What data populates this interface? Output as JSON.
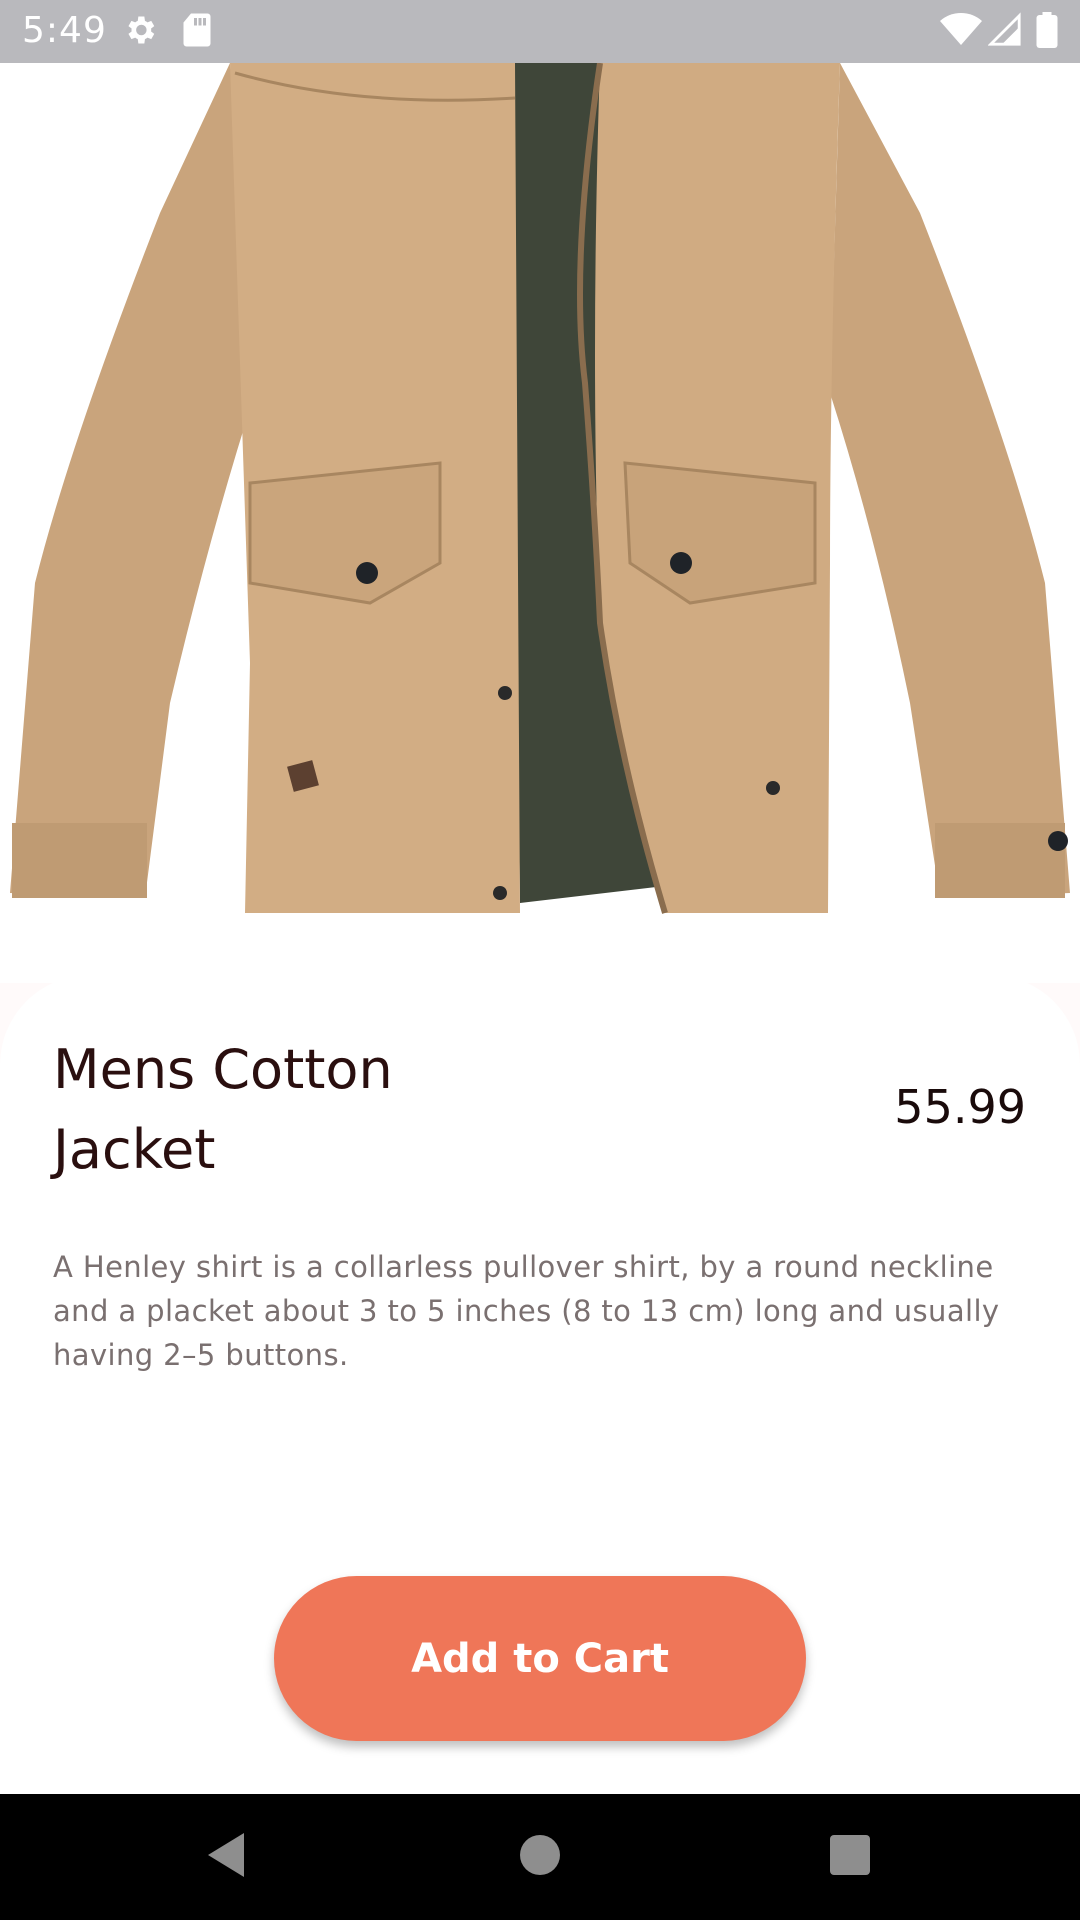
{
  "status_bar": {
    "time": "5:49",
    "icons": [
      "settings-icon",
      "sd-card-icon",
      "wifi-icon",
      "signal-icon",
      "battery-icon"
    ],
    "background": "#b9b9bd"
  },
  "product": {
    "image_subject": "jacket-photo",
    "name": "Mens Cotton Jacket",
    "price": "55.99",
    "description": "A Henley shirt is a collarless pullover shirt, by a round neckline and a placket about 3 to 5 inches (8 to 13 cm) long and usually having 2–5 buttons."
  },
  "actions": {
    "add_to_cart_label": "Add to Cart",
    "accent_color": "#ef7658"
  },
  "nav_bar": {
    "icons": [
      "back-icon",
      "home-icon",
      "recents-icon"
    ]
  }
}
